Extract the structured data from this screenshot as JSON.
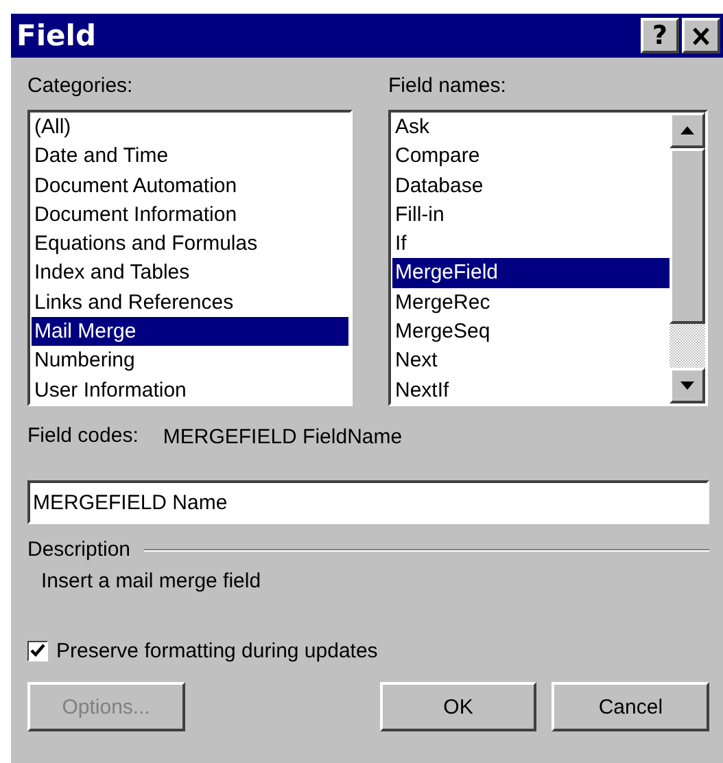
{
  "window": {
    "title": "Field",
    "help_button": "?"
  },
  "categories": {
    "label": "Categories:",
    "items": [
      {
        "label": "(All)",
        "selected": false
      },
      {
        "label": "Date and Time",
        "selected": false
      },
      {
        "label": "Document Automation",
        "selected": false
      },
      {
        "label": "Document Information",
        "selected": false
      },
      {
        "label": "Equations and Formulas",
        "selected": false
      },
      {
        "label": "Index and Tables",
        "selected": false
      },
      {
        "label": "Links and References",
        "selected": false
      },
      {
        "label": "Mail Merge",
        "selected": true
      },
      {
        "label": "Numbering",
        "selected": false
      },
      {
        "label": "User Information",
        "selected": false
      }
    ]
  },
  "field_names": {
    "label": "Field names:",
    "items": [
      {
        "label": "Ask",
        "selected": false
      },
      {
        "label": "Compare",
        "selected": false
      },
      {
        "label": "Database",
        "selected": false
      },
      {
        "label": "Fill-in",
        "selected": false
      },
      {
        "label": "If",
        "selected": false
      },
      {
        "label": "MergeField",
        "selected": true
      },
      {
        "label": "MergeRec",
        "selected": false
      },
      {
        "label": "MergeSeq",
        "selected": false
      },
      {
        "label": "Next",
        "selected": false
      },
      {
        "label": "NextIf",
        "selected": false
      }
    ]
  },
  "field_codes": {
    "label": "Field codes:",
    "syntax": "MERGEFIELD FieldName",
    "value": "MERGEFIELD Name"
  },
  "description": {
    "label": "Description",
    "text": "Insert a mail merge field"
  },
  "preserve_formatting": {
    "label": "Preserve formatting during updates",
    "checked": true
  },
  "buttons": [
    {
      "label": "Options...",
      "disabled": true
    },
    {
      "label": "OK",
      "disabled": false
    },
    {
      "label": "Cancel",
      "disabled": false
    }
  ]
}
